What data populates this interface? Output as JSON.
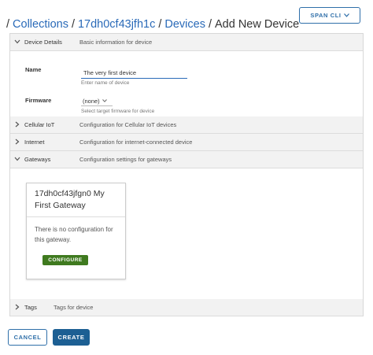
{
  "breadcrumb": {
    "separator": "/",
    "items": [
      "Collections",
      "17dh0cf43jfh1c",
      "Devices"
    ],
    "current": "Add New Device"
  },
  "toolbar": {
    "span_cli_label": "SPAN CLI",
    "span_cli_icon": "chevron-down-icon"
  },
  "sections": {
    "device_details": {
      "title": "Device Details",
      "description": "Basic information for device",
      "expanded": true
    },
    "cellular_iot": {
      "title": "Cellular IoT",
      "description": "Configuration for Cellular IoT devices",
      "expanded": false
    },
    "internet": {
      "title": "Internet",
      "description": "Configuration for internet-connected device",
      "expanded": false
    },
    "gateways": {
      "title": "Gateways",
      "description": "Configuration settings for gateways",
      "expanded": true
    },
    "tags": {
      "title": "Tags",
      "description": "Tags for device",
      "expanded": false
    }
  },
  "form": {
    "name_label": "Name",
    "name_value": "The very first device",
    "name_hint": "Enter name of device",
    "firmware_label": "Firmware",
    "firmware_value": "(none)",
    "firmware_hint": "Select target firmware for device"
  },
  "gateway_card": {
    "title": "17dh0cf43jfgn0 My First Gateway",
    "body": "There is no configuration for this gateway.",
    "configure_label": "CONFIGURE"
  },
  "actions": {
    "cancel_label": "CANCEL",
    "create_label": "CREATE"
  },
  "colors": {
    "link": "#2a6ab8",
    "primary": "#1c5f93",
    "success": "#3f7a1f",
    "panel_header": "#f2f2f2"
  }
}
